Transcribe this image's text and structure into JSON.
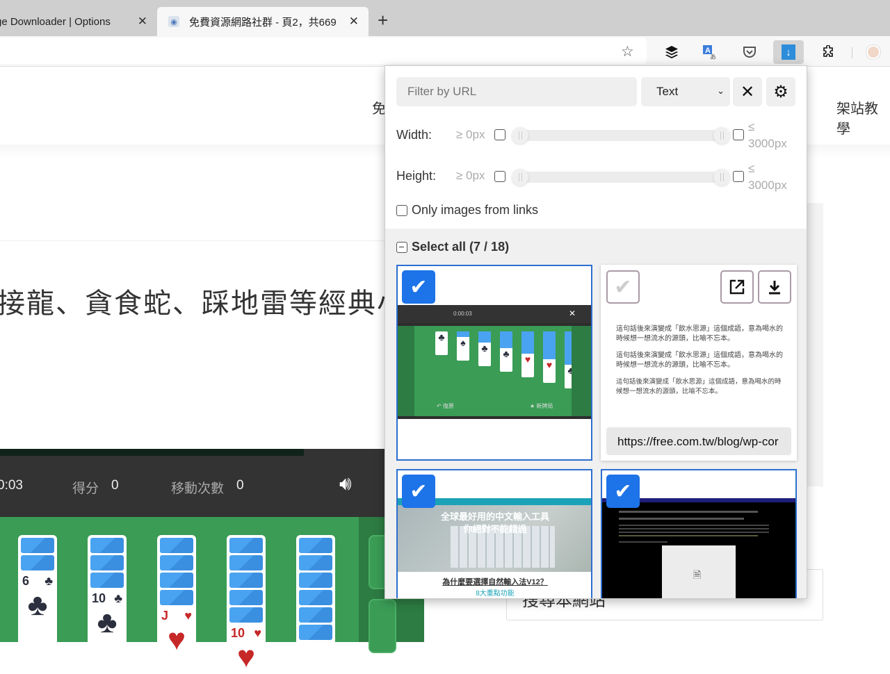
{
  "browser": {
    "tabs": [
      {
        "title": "ge Downloader | Options",
        "active": false
      },
      {
        "title": "免費資源網路社群 - 頁2，共669",
        "active": true
      }
    ],
    "new_tab_label": "+",
    "close_label": "✕",
    "toolbar_icons": [
      "bookmark-add-icon",
      "buffer-icon",
      "translate-icon",
      "pocket-icon",
      "image-downloader-icon",
      "extensions-icon",
      "profile-avatar"
    ]
  },
  "page": {
    "nav_left": "免",
    "nav_right": "架站教學",
    "headline": "接龍、貪食蛇、踩地雷等經典小",
    "search_box_text": "搜尋本網站",
    "game": {
      "timer": "0:03",
      "score_label": "得分",
      "score": "0",
      "moves_label": "移動次數",
      "moves": "0",
      "cards": [
        {
          "rank": "6",
          "suit": "♣",
          "color": "black",
          "hidden": 2
        },
        {
          "rank": "10",
          "suit": "♣",
          "color": "black",
          "hidden": 3
        },
        {
          "rank": "J",
          "suit": "♥",
          "color": "red",
          "hidden": 4
        },
        {
          "rank": "10",
          "suit": "♥",
          "color": "red",
          "hidden": 5
        },
        {
          "rank": "",
          "suit": "",
          "color": "black",
          "hidden": 6
        }
      ]
    }
  },
  "popup": {
    "filter_placeholder": "Filter by URL",
    "filter_value": "",
    "select_value": "Text",
    "clear_icon": "✕",
    "settings_icon": "⚙",
    "width": {
      "label": "Width:",
      "min_label": "≥ 0px",
      "max_sym": "≤",
      "max_label": "3000px",
      "min_value": 0,
      "max_value": 3000
    },
    "height": {
      "label": "Height:",
      "min_label": "≥ 0px",
      "max_sym": "≤",
      "max_label": "3000px",
      "min_value": 0,
      "max_value": 3000
    },
    "only_links_label": "Only images from links",
    "select_all_label": "Select all (7 / 18)",
    "selected_count": 7,
    "total_count": 18,
    "images": [
      {
        "selected": true,
        "kind": "solitaire-screenshot",
        "mini_timer": "0:00:03",
        "mini_undo": "復原",
        "mini_new": "新牌局"
      },
      {
        "selected": false,
        "kind": "text-image",
        "lines": [
          "這句話後來演變成「飲水思源」這個成語，意為喝水的時候想一想流水的源頭，比喻不忘本。",
          "這句話後來演變成「飲水思源」這個成語，意為喝水的時候想一想流水的源頭，比喻不忘本。",
          "這句話後來演變成「飲水思源」這個成語，意為喝水的時候想一想流水的源頭，比喻不忘本。"
        ],
        "url": "https://free.com.tw/blog/wp-cor",
        "open_icon": "↗",
        "download_icon": "⬇"
      },
      {
        "selected": true,
        "kind": "ime-banner",
        "heading1": "全球最好用的中文輸入工具",
        "heading2": "你絕對不能錯過",
        "caption": "為什麼要選擇自然輸入法V12？",
        "subcaption": "8大重點功能"
      },
      {
        "selected": true,
        "kind": "dark-forum-screenshot"
      }
    ]
  }
}
